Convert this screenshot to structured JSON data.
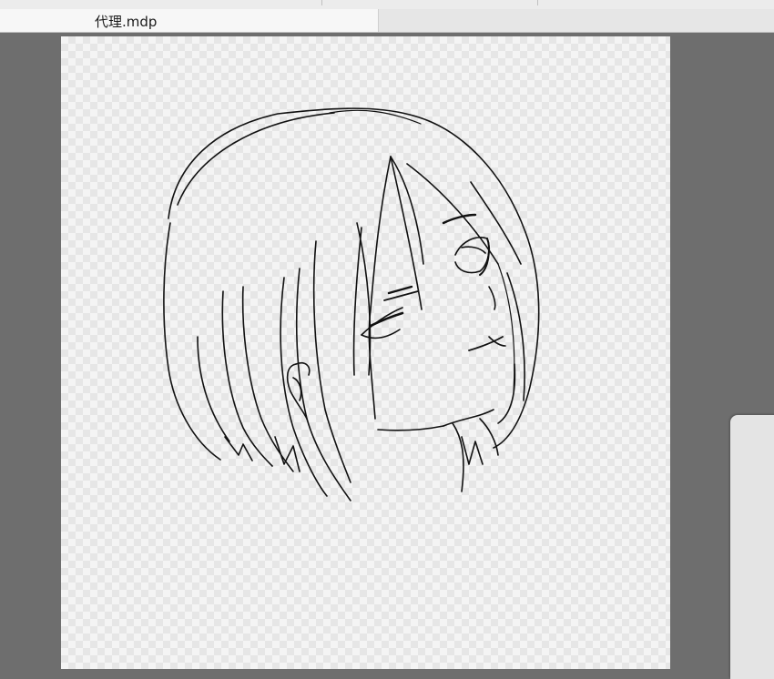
{
  "document_tab": {
    "title": "代理.mdp"
  },
  "canvas": {
    "background": "transparent-checkerboard",
    "stroke_color": "#111111"
  },
  "icons": {
    "sketch": "line-art-sketch"
  }
}
